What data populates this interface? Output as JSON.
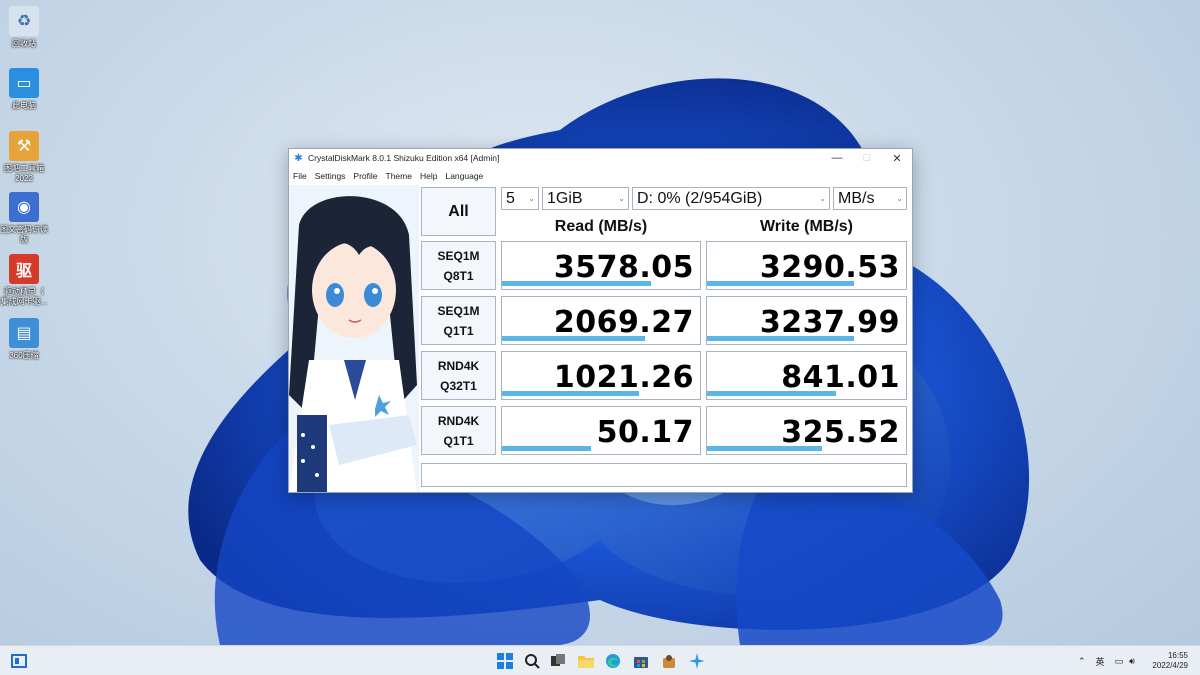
{
  "desktop": {
    "icons": [
      {
        "label": "回收站",
        "icon": "recycle-bin-icon"
      },
      {
        "label": "此电脑",
        "icon": "computer-icon"
      },
      {
        "label": "图吧工具箱\n2022",
        "icon": "toolbox-icon"
      },
      {
        "label": "图文密码识读版",
        "icon": "app-icon"
      },
      {
        "label": "驱动精灵（\n集成网卡驱...",
        "icon": "driver-icon"
      },
      {
        "label": "360压缩",
        "icon": "archive-icon"
      }
    ]
  },
  "window": {
    "title": "CrystalDiskMark 8.0.1 Shizuku Edition x64 [Admin]",
    "menu": [
      "File",
      "Settings",
      "Profile",
      "Theme",
      "Help",
      "Language"
    ],
    "all_label": "All",
    "count_value": "5",
    "size_value": "1GiB",
    "drive_value": "D: 0% (2/954GiB)",
    "unit_value": "MB/s",
    "read_header": "Read (MB/s)",
    "write_header": "Write (MB/s)",
    "rows": [
      {
        "line1": "SEQ1M",
        "line2": "Q8T1",
        "read": "3578.05",
        "write": "3290.53",
        "read_fill": 0.75,
        "write_fill": 0.74
      },
      {
        "line1": "SEQ1M",
        "line2": "Q1T1",
        "read": "2069.27",
        "write": "3237.99",
        "read_fill": 0.72,
        "write_fill": 0.74
      },
      {
        "line1": "RND4K",
        "line2": "Q32T1",
        "read": "1021.26",
        "write": "841.01",
        "read_fill": 0.69,
        "write_fill": 0.65
      },
      {
        "line1": "RND4K",
        "line2": "Q1T1",
        "read": "50.17",
        "write": "325.52",
        "read_fill": 0.45,
        "write_fill": 0.58
      }
    ]
  },
  "taskbar": {
    "tray_lang": "英",
    "time": "16:55",
    "date": "2022/4/29"
  },
  "colors": {
    "accent": "#5ab6e6",
    "wallpaper_blue": "#1a55d6"
  }
}
